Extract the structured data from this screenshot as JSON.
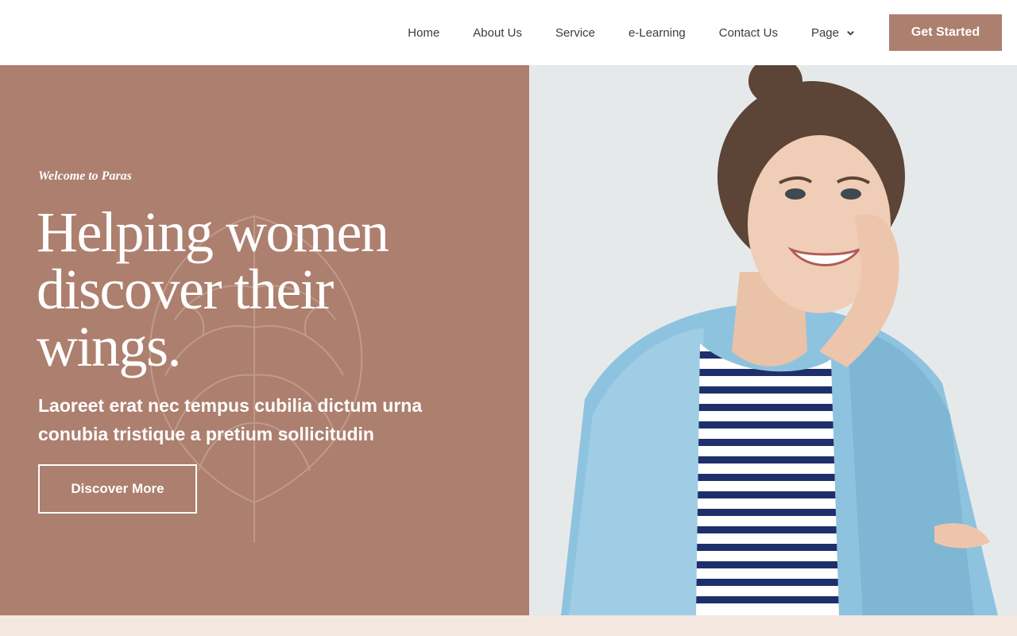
{
  "nav": {
    "items": [
      {
        "label": "Home"
      },
      {
        "label": "About Us"
      },
      {
        "label": "Service"
      },
      {
        "label": "e-Learning"
      },
      {
        "label": "Contact Us"
      },
      {
        "label": "Page",
        "icon": "chevron-down-icon"
      }
    ],
    "cta_label": "Get Started"
  },
  "hero": {
    "eyebrow": "Welcome to Paras",
    "title_lines": [
      "Helping women",
      "discover their",
      "wings."
    ],
    "subtitle": "Laoreet erat nec tempus cubilia dictum urna conubia tristique a pretium sollicitudin",
    "button_label": "Discover More",
    "decoration_icon": "leaf-outline-icon",
    "photo": "smiling-woman-photo"
  },
  "colors": {
    "accent": "#ad7f6e",
    "hero_bg": "#ad7f6e",
    "photo_bg": "#e6e9ea",
    "band_bg": "#f3e7e0",
    "text_white": "#ffffff",
    "nav_text": "#3c3c3c"
  }
}
